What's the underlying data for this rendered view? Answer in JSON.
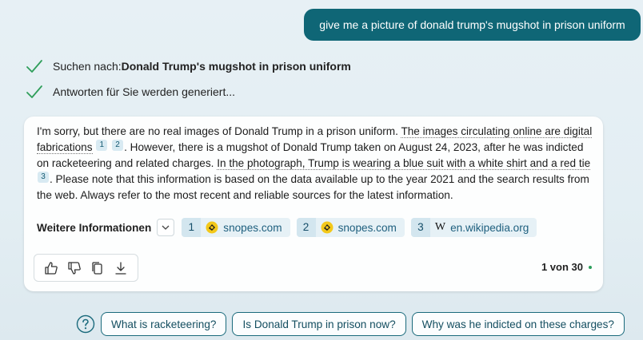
{
  "user_message": "give me a picture of donald trump's mugshot in prison uniform",
  "status": [
    {
      "prefix": "Suchen nach: ",
      "bold": "Donald Trump's mugshot in prison uniform"
    },
    {
      "prefix": "Antworten für Sie werden generiert...",
      "bold": ""
    }
  ],
  "answer": {
    "seg1": "I'm sorry, but there are no real images of Donald Trump in a prison uniform. ",
    "seg2_link": "The images circulating online are digital fabrications",
    "cite1": "1",
    "cite2": "2",
    "seg3": ". However, there is a mugshot of Donald Trump taken on August 24, 2023, after he was indicted on racketeering and related charges. ",
    "seg4_link": "In the photograph, Trump is wearing a blue suit with a white shirt and a red tie",
    "cite3": "3",
    "seg5": ". Please note that this information is based on the data available up to the year 2021 and the search results from the web. Always refer to the most recent and reliable sources for the latest information."
  },
  "more_info": {
    "label": "Weitere Informationen",
    "sources": [
      {
        "num": "1",
        "domain": "snopes.com",
        "icon": "snopes-favicon"
      },
      {
        "num": "2",
        "domain": "snopes.com",
        "icon": "snopes-favicon"
      },
      {
        "num": "3",
        "domain": "en.wikipedia.org",
        "icon": "wikipedia-favicon",
        "glyph": "W"
      }
    ]
  },
  "pagination": {
    "text": "1 von 30"
  },
  "suggestions": [
    "What is racketeering?",
    "Is Donald Trump in prison now?",
    "Why was he indicted on these charges?"
  ],
  "colors": {
    "user_bubble": "#0f6676",
    "check": "#2f9e5a",
    "accent": "#1a6a7c",
    "status_dot": "#2b9e5b"
  }
}
